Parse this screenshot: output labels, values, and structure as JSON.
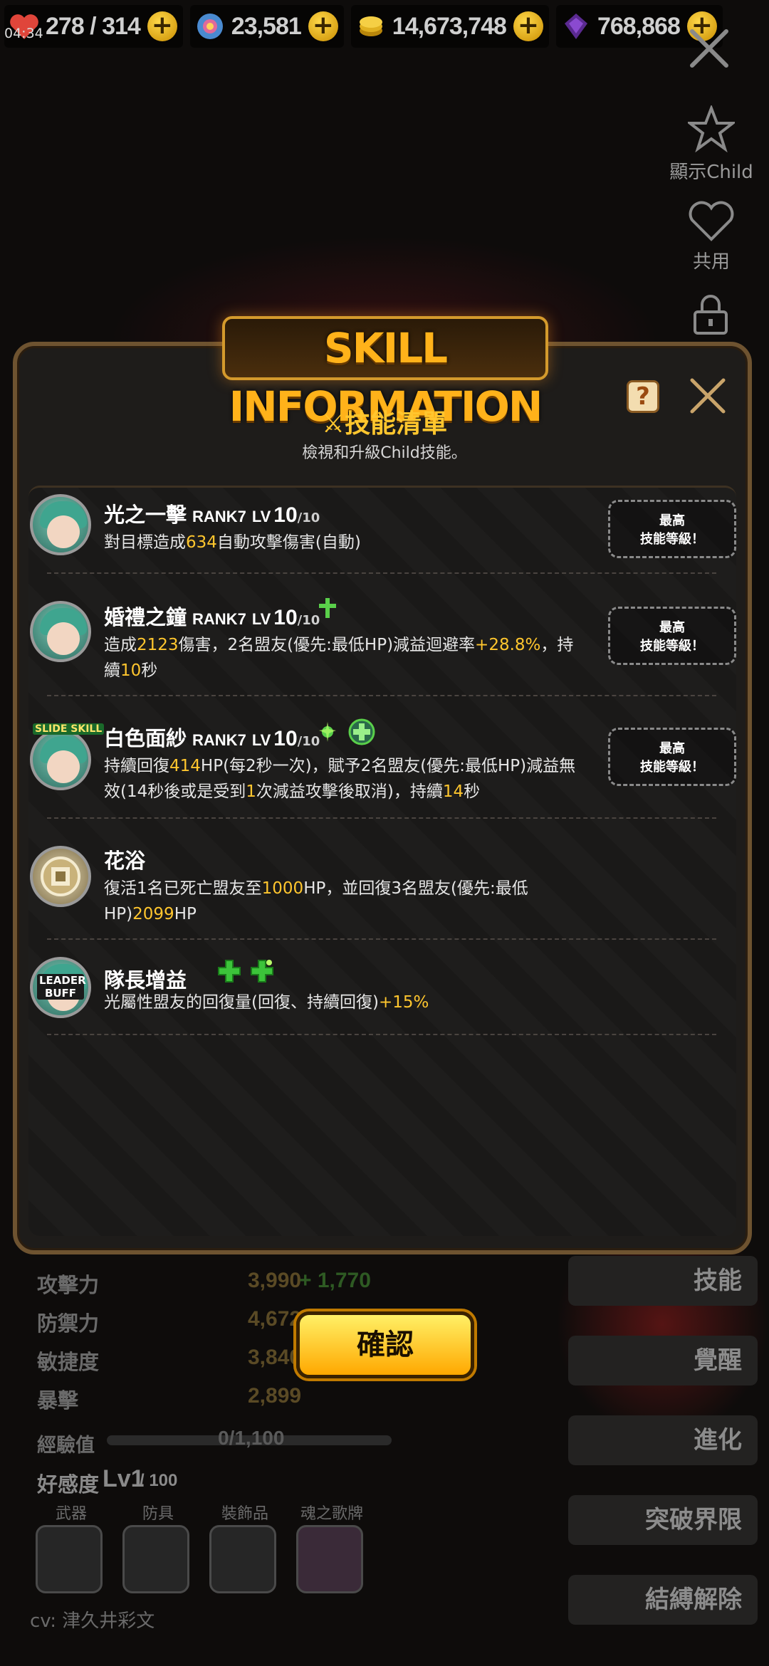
{
  "status": {
    "time": "04:34"
  },
  "resources": [
    {
      "icon": "heart-icon",
      "value": "278 / 314"
    },
    {
      "icon": "crystal-icon",
      "value": "23,581"
    },
    {
      "icon": "gold-icon",
      "value": "14,673,748"
    },
    {
      "icon": "soul-gem-icon",
      "value": "768,868"
    }
  ],
  "side_menu": {
    "show_child": "顯示Child",
    "share": "共用"
  },
  "popup": {
    "banner": "SKILL INFORMATION",
    "help": "?",
    "title": "技能清單",
    "subtitle": "檢視和升級Child技能。",
    "max_label_1": "最高",
    "max_label_2": "技能等級！"
  },
  "skills": [
    {
      "name": "光之一擊",
      "rank": "RANK7",
      "lv_prefix": "LV",
      "lv": "10",
      "lv_max": "/10",
      "desc": [
        {
          "t": "對目標造成",
          "h": false
        },
        {
          "t": "634",
          "h": true
        },
        {
          "t": "自動攻擊傷害(自動)",
          "h": false
        }
      ]
    },
    {
      "name": "婚禮之鐘",
      "rank": "RANK7",
      "lv_prefix": "LV",
      "lv": "10",
      "lv_max": "/10",
      "desc": [
        {
          "t": "造成",
          "h": false
        },
        {
          "t": "2123",
          "h": true
        },
        {
          "t": "傷害，2名盟友(優先:最低HP)減益迴避率",
          "h": false
        },
        {
          "t": "+28.8%",
          "h": true
        },
        {
          "t": "，持續",
          "h": false
        },
        {
          "t": "10",
          "h": true
        },
        {
          "t": "秒",
          "h": false
        }
      ]
    },
    {
      "name": "白色面紗",
      "rank": "RANK7",
      "lv_prefix": "LV",
      "lv": "10",
      "lv_max": "/10",
      "tag": "SLIDE SKILL",
      "desc": [
        {
          "t": "持續回復",
          "h": false
        },
        {
          "t": "414",
          "h": true
        },
        {
          "t": "HP(每2秒一次)，賦予2名盟友(優先:最低HP)減益無效(14秒後或是受到",
          "h": false
        },
        {
          "t": "1",
          "h": true
        },
        {
          "t": "次減益攻擊後取消)，持續",
          "h": false
        },
        {
          "t": "14",
          "h": true
        },
        {
          "t": "秒",
          "h": false
        }
      ]
    },
    {
      "name": "花浴",
      "desc": [
        {
          "t": "復活1名已死亡盟友至",
          "h": false
        },
        {
          "t": "1000",
          "h": true
        },
        {
          "t": "HP，並回復3名盟友(優先:最低HP)",
          "h": false
        },
        {
          "t": "2099",
          "h": true
        },
        {
          "t": "HP",
          "h": false
        }
      ]
    },
    {
      "name": "隊長增益",
      "tag": "LEADER BUFF",
      "desc": [
        {
          "t": "光屬性盟友的回復量(回復、持續回復)",
          "h": false
        },
        {
          "t": "+15%",
          "h": true
        }
      ]
    }
  ],
  "stats": [
    {
      "label": "攻擊力",
      "value": "3,990",
      "bonus": "+ 1,770"
    },
    {
      "label": "防禦力",
      "value": "4,672",
      "bonus": ""
    },
    {
      "label": "敏捷度",
      "value": "3,840",
      "bonus": ""
    },
    {
      "label": "暴擊",
      "value": "2,899",
      "bonus": ""
    }
  ],
  "exp": {
    "label": "經驗值",
    "value": "0/1,100",
    "progress": 0
  },
  "affinity": {
    "label": "好感度",
    "lv": "Lv1",
    "max": "/ 100"
  },
  "equipment_labels": [
    "武器",
    "防具",
    "裝飾品",
    "魂之歌牌"
  ],
  "side_buttons": [
    "技能",
    "覺醒",
    "進化",
    "突破界限",
    "結縛解除"
  ],
  "confirm_label": "確認",
  "cv": "cv: 津久井彩文"
}
